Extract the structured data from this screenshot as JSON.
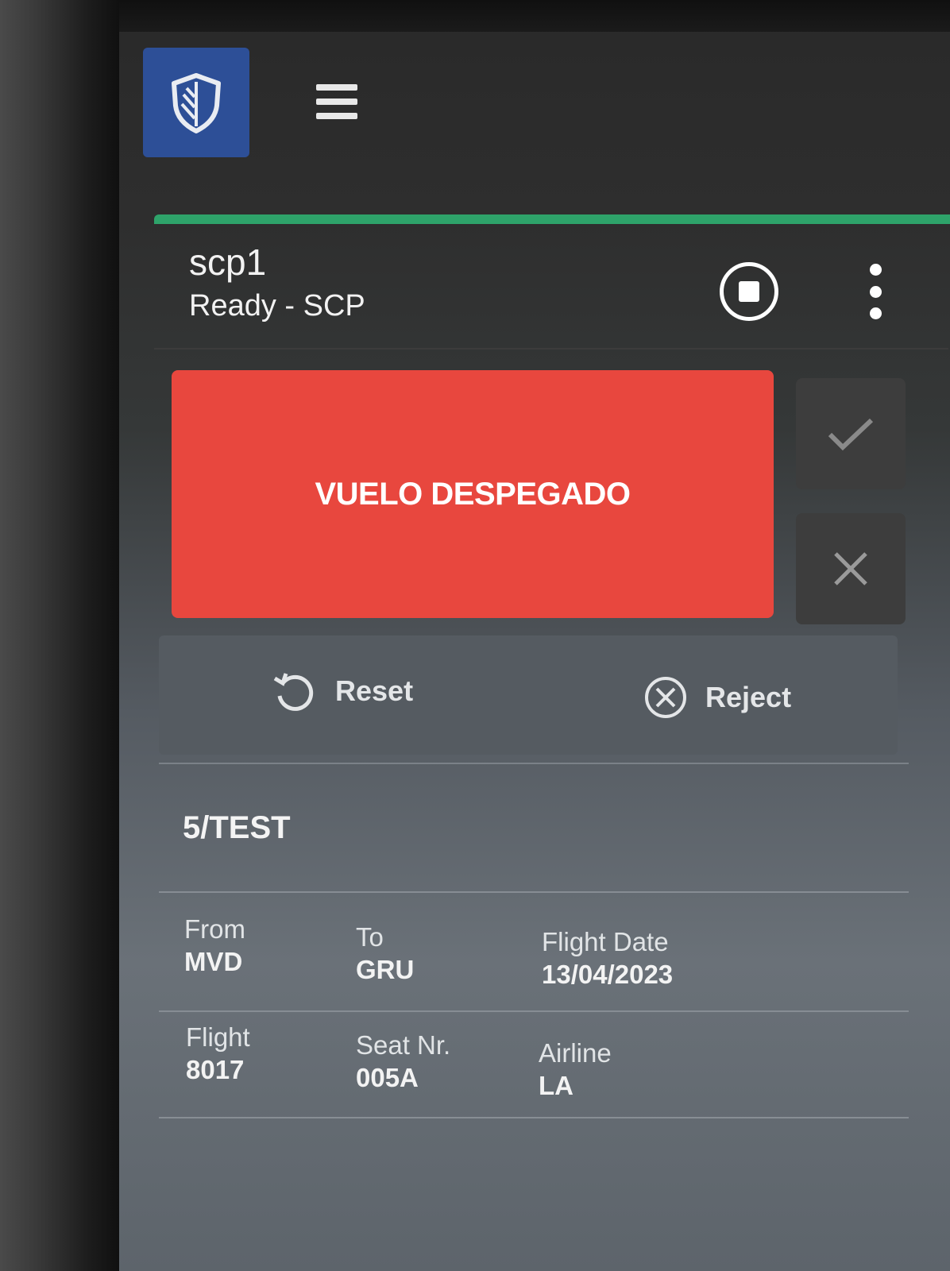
{
  "header": {
    "device_name": "scp1",
    "status": "Ready - SCP"
  },
  "alert": {
    "message": "VUELO DESPEGADO",
    "color": "#e8473e"
  },
  "actions": {
    "reset_label": "Reset",
    "reject_label": "Reject"
  },
  "passenger": {
    "name": "5/TEST"
  },
  "flight_info": {
    "from_label": "From",
    "from_value": "MVD",
    "to_label": "To",
    "to_value": "GRU",
    "date_label": "Flight Date",
    "date_value": "13/04/2023",
    "flight_label": "Flight",
    "flight_value": "8017",
    "seat_label": "Seat Nr.",
    "seat_value": "005A",
    "airline_label": "Airline",
    "airline_value": "LA"
  },
  "icons": {
    "logo": "shield-icon",
    "menu": "hamburger-menu-icon",
    "stop": "stop-circle-icon",
    "more": "more-vert-icon",
    "confirm": "check-icon",
    "cancel": "close-icon",
    "reset": "reset-icon",
    "reject": "reject-circle-icon"
  },
  "colors": {
    "logo_bg": "#2d4f97",
    "progress": "#2ea36a",
    "alert": "#e8473e"
  }
}
